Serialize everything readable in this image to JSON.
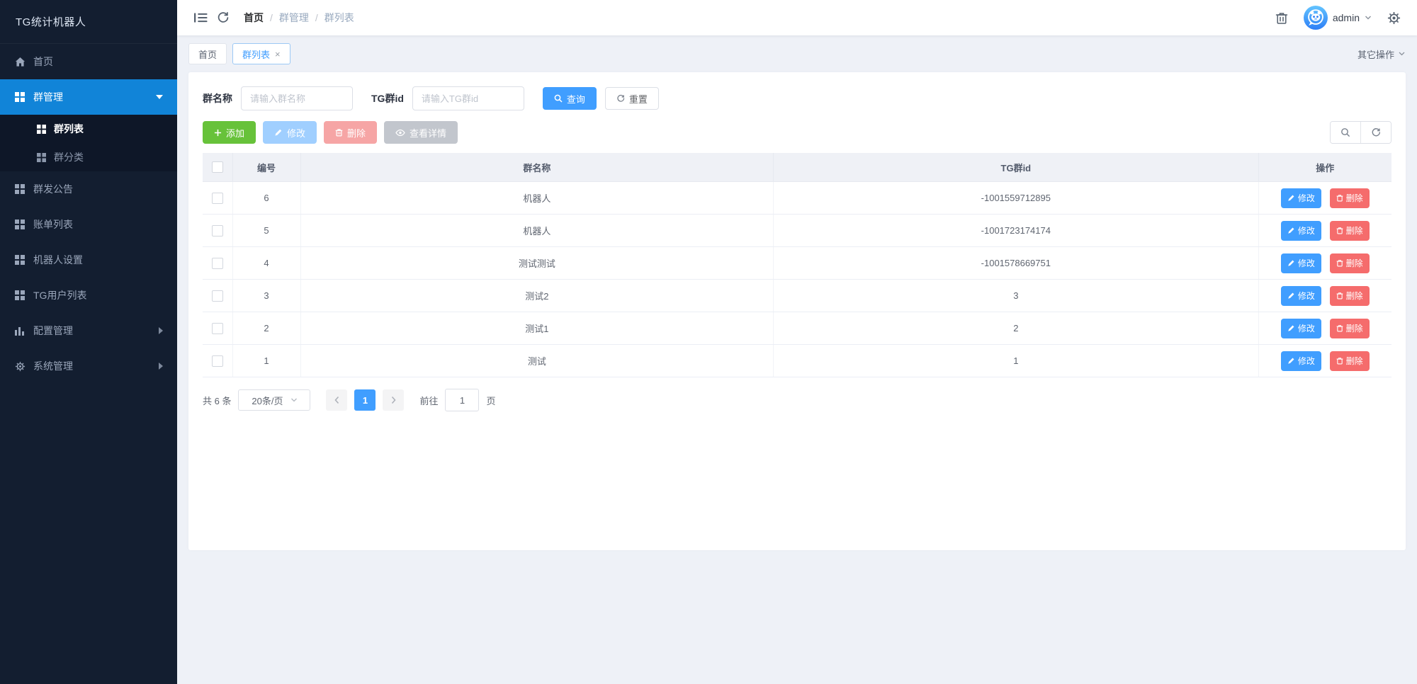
{
  "app": {
    "title": "TG统计机器人"
  },
  "sidebar": {
    "items": [
      {
        "label": "首页",
        "icon": "home-icon"
      },
      {
        "label": "群管理",
        "icon": "grid-icon",
        "children": [
          {
            "label": "群列表"
          },
          {
            "label": "群分类"
          }
        ]
      },
      {
        "label": "群发公告",
        "icon": "grid-icon"
      },
      {
        "label": "账单列表",
        "icon": "grid-icon"
      },
      {
        "label": "机器人设置",
        "icon": "grid-icon"
      },
      {
        "label": "TG用户列表",
        "icon": "grid-icon"
      },
      {
        "label": "配置管理",
        "icon": "chart-icon"
      },
      {
        "label": "系统管理",
        "icon": "gear-icon"
      }
    ]
  },
  "topbar": {
    "breadcrumb": {
      "home": "首页",
      "sep": "/",
      "level2": "群管理",
      "level3": "群列表"
    },
    "username": "admin"
  },
  "tabs": {
    "home": "首页",
    "current": "群列表",
    "close_glyph": "×",
    "more_label": "其它操作"
  },
  "filters": {
    "name_label": "群名称",
    "name_placeholder": "请输入群名称",
    "id_label": "TG群id",
    "id_placeholder": "请输入TG群id",
    "search_button": "查询",
    "reset_button": "重置"
  },
  "toolbar": {
    "add_button": "添加",
    "edit_button": "修改",
    "delete_button": "删除",
    "detail_button": "查看详情"
  },
  "table": {
    "headers": {
      "no": "编号",
      "name": "群名称",
      "tgid": "TG群id",
      "actions": "操作"
    },
    "action_edit": "修改",
    "action_delete": "删除",
    "rows": [
      {
        "no": "6",
        "name": "机器人",
        "tgid": "-1001559712895"
      },
      {
        "no": "5",
        "name": "机器人",
        "tgid": "-1001723174174"
      },
      {
        "no": "4",
        "name": "测试测试",
        "tgid": "-1001578669751"
      },
      {
        "no": "3",
        "name": "测试2",
        "tgid": "3"
      },
      {
        "no": "2",
        "name": "测试1",
        "tgid": "2"
      },
      {
        "no": "1",
        "name": "测试",
        "tgid": "1"
      }
    ]
  },
  "pagination": {
    "total": "共 6 条",
    "page_size": "20条/页",
    "page": "1",
    "goto_label": "前往",
    "goto_value": "1",
    "goto_suffix": "页"
  },
  "colors": {
    "accent": "#409eff",
    "success": "#67c23a",
    "danger": "#f56c6c",
    "sidebar_bg": "#131e30",
    "sidebar_active_bg": "#1184d8",
    "page_bg": "#eef1f7"
  }
}
